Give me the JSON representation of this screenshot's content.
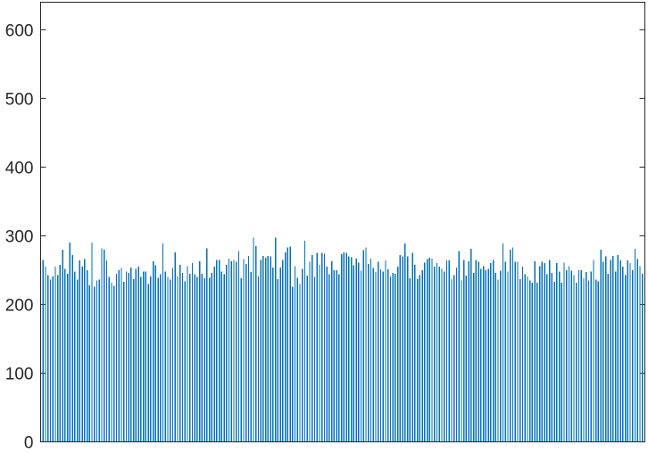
{
  "chart_data": {
    "type": "bar",
    "title": "",
    "xlabel": "",
    "ylabel": "",
    "ylim": [
      0,
      640
    ],
    "yticks": [
      0,
      100,
      200,
      300,
      400,
      500,
      600
    ],
    "ytick_labels": [
      "0",
      "100",
      "200",
      "300",
      "400",
      "500",
      "600"
    ],
    "x_tick_labels_visible": false,
    "grid": false,
    "bar_color": "#0072BD",
    "x": [
      1,
      2,
      3,
      4,
      5,
      6,
      7,
      8,
      9,
      10,
      11,
      12,
      13,
      14,
      15,
      16,
      17,
      18,
      19,
      20,
      21,
      22,
      23,
      24,
      25,
      26,
      27,
      28,
      29,
      30,
      31,
      32,
      33,
      34,
      35,
      36,
      37,
      38,
      39,
      40,
      41,
      42,
      43,
      44,
      45,
      46,
      47,
      48,
      49,
      50,
      51,
      52,
      53,
      54,
      55,
      56,
      57,
      58,
      59,
      60,
      61,
      62,
      63,
      64,
      65,
      66,
      67,
      68,
      69,
      70,
      71,
      72,
      73,
      74,
      75,
      76,
      77,
      78,
      79,
      80,
      81,
      82,
      83,
      84,
      85,
      86,
      87,
      88,
      89,
      90,
      91,
      92,
      93,
      94,
      95,
      96,
      97,
      98,
      99,
      100,
      101,
      102,
      103,
      104,
      105,
      106,
      107,
      108,
      109,
      110,
      111,
      112,
      113,
      114,
      115,
      116,
      117,
      118,
      119,
      120,
      121,
      122,
      123,
      124,
      125,
      126,
      127,
      128,
      129,
      130,
      131,
      132,
      133,
      134,
      135,
      136,
      137,
      138,
      139,
      140,
      141,
      142,
      143,
      144,
      145,
      146,
      147,
      148,
      149,
      150,
      151,
      152,
      153,
      154,
      155,
      156,
      157,
      158,
      159,
      160,
      161,
      162,
      163,
      164,
      165,
      166,
      167,
      168,
      169,
      170,
      171,
      172,
      173,
      174,
      175,
      176,
      177,
      178,
      179,
      180,
      181,
      182,
      183,
      184,
      185,
      186,
      187,
      188,
      189,
      190,
      191,
      192,
      193,
      194,
      195,
      196,
      197,
      198,
      199,
      200,
      201,
      202,
      203,
      204,
      205,
      206,
      207,
      208,
      209,
      210,
      211,
      212,
      213,
      214,
      215,
      216,
      217,
      218,
      219,
      220,
      221,
      222,
      223,
      224,
      225,
      226,
      227,
      228,
      229,
      230,
      231,
      232,
      233,
      234,
      235,
      236,
      237,
      238,
      239,
      240,
      241,
      242,
      243,
      244,
      245,
      246,
      247,
      248,
      249,
      250,
      251,
      252,
      253,
      254,
      255,
      256
    ],
    "values": [
      265,
      255,
      243,
      236,
      241,
      255,
      243,
      258,
      280,
      252,
      245,
      290,
      272,
      248,
      236,
      264,
      255,
      266,
      250,
      228,
      290,
      226,
      235,
      236,
      282,
      280,
      264,
      240,
      232,
      227,
      245,
      250,
      253,
      233,
      248,
      246,
      254,
      237,
      252,
      255,
      240,
      248,
      248,
      230,
      241,
      263,
      257,
      239,
      244,
      289,
      248,
      240,
      236,
      253,
      276,
      241,
      258,
      246,
      234,
      256,
      245,
      260,
      244,
      240,
      263,
      245,
      238,
      282,
      239,
      246,
      255,
      265,
      265,
      248,
      244,
      258,
      267,
      263,
      265,
      262,
      278,
      238,
      266,
      259,
      271,
      247,
      297,
      285,
      241,
      265,
      271,
      268,
      271,
      270,
      254,
      297,
      237,
      254,
      265,
      276,
      283,
      284,
      226,
      256,
      239,
      230,
      252,
      293,
      242,
      262,
      272,
      240,
      275,
      258,
      275,
      274,
      255,
      244,
      263,
      250,
      250,
      244,
      273,
      276,
      275,
      270,
      269,
      257,
      267,
      261,
      249,
      279,
      283,
      259,
      267,
      253,
      247,
      262,
      251,
      248,
      264,
      251,
      241,
      246,
      245,
      255,
      272,
      270,
      289,
      270,
      238,
      275,
      258,
      237,
      243,
      250,
      261,
      266,
      268,
      267,
      255,
      260,
      255,
      252,
      248,
      264,
      264,
      237,
      243,
      254,
      278,
      235,
      265,
      242,
      263,
      281,
      246,
      265,
      262,
      252,
      256,
      250,
      252,
      260,
      265,
      246,
      236,
      249,
      289,
      262,
      248,
      280,
      283,
      262,
      262,
      237,
      255,
      244,
      241,
      235,
      232,
      263,
      232,
      256,
      262,
      260,
      244,
      265,
      246,
      233,
      260,
      248,
      232,
      261,
      250,
      256,
      249,
      243,
      232,
      250,
      250,
      238,
      247,
      235,
      248,
      265,
      236,
      234,
      280,
      262,
      270,
      245,
      265,
      271,
      248,
      272,
      264,
      255,
      243,
      264,
      260,
      250,
      281,
      266,
      256,
      245
    ]
  }
}
